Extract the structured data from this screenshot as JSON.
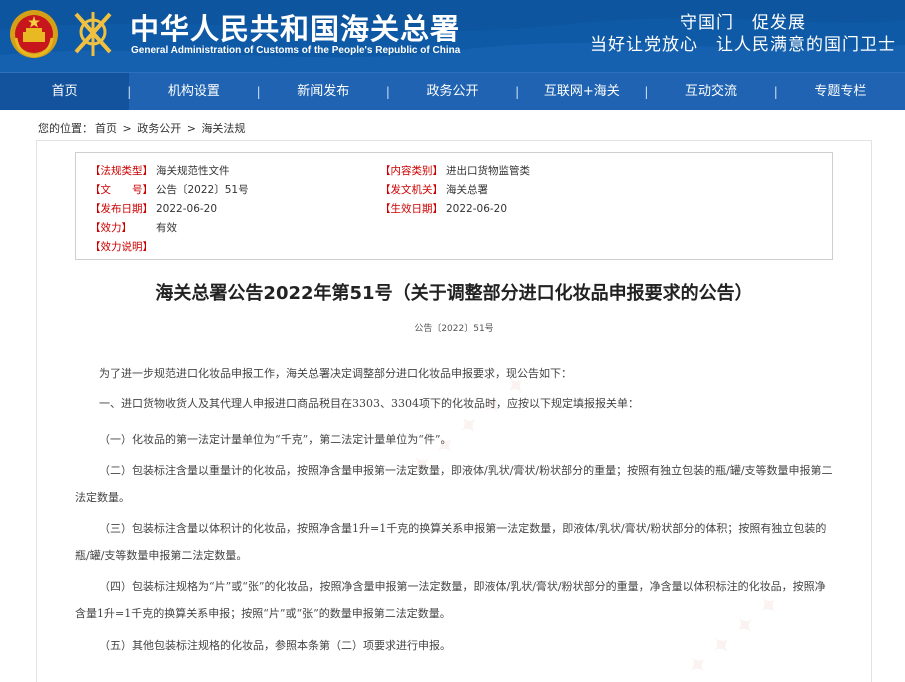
{
  "header": {
    "title": "中华人民共和国海关总署",
    "subtitle": "General Administration of Customs of the People's Republic of China",
    "slogan_line1": "守国门　促发展",
    "slogan_line2": "当好让党放心　让人民满意的国门卫士",
    "colors": {
      "header_bg": "#0f5aa6",
      "nav_bg": "#1f63b2",
      "key_red": "#cc0000"
    }
  },
  "nav": {
    "items": [
      {
        "label": "首页"
      },
      {
        "label": "机构设置"
      },
      {
        "label": "新闻发布"
      },
      {
        "label": "政务公开"
      },
      {
        "label": "互联网+海关"
      },
      {
        "label": "互动交流"
      },
      {
        "label": "专题专栏"
      }
    ],
    "separator": "|"
  },
  "breadcrumb": {
    "prefix": "您的位置：",
    "items": [
      "首页",
      "政务公开",
      "海关法规"
    ],
    "separator": " > "
  },
  "meta": {
    "type_key": "【法规类型】",
    "type_val": "海关规范性文件",
    "category_key": "【内容类别】",
    "category_val": "进出口货物监管类",
    "docno_key": "【文　　号】",
    "docno_val": "公告〔2022〕51号",
    "issuer_key": "【发文机关】",
    "issuer_val": "海关总署",
    "pubdate_key": "【发布日期】",
    "pubdate_val": "2022-06-20",
    "effdate_key": "【生效日期】",
    "effdate_val": "2022-06-20",
    "validity_key": "【效力】",
    "validity_val": "有效",
    "note_key": "【效力说明】",
    "note_val": ""
  },
  "document": {
    "title": "海关总署公告2022年第51号（关于调整部分进口化妆品申报要求的公告）",
    "number": "公告〔2022〕51号",
    "paragraphs": [
      "为了进一步规范进口化妆品申报工作，海关总署决定调整部分进口化妆品申报要求，现公告如下：",
      "一、进口货物收货人及其代理人申报进口商品税目在3303、3304项下的化妆品时，应按以下规定填报报关单：",
      "（一）化妆品的第一法定计量单位为“千克”，第二法定计量单位为“件”。",
      "（二）包装标注含量以重量计的化妆品，按照净含量申报第一法定数量，即液体/乳状/膏状/粉状部分的重量；按照有独立包装的瓶/罐/支等数量申报第二法定数量。",
      "（三）包装标注含量以体积计的化妆品，按照净含量1升=1千克的换算关系申报第一法定数量，即液体/乳状/膏状/粉状部分的体积；按照有独立包装的瓶/罐/支等数量申报第二法定数量。",
      "（四）包装标注规格为“片”或“张”的化妆品，按照净含量申报第一法定数量，即液体/乳状/膏状/粉状部分的重量，净含量以体积标注的化妆品，按照净含量1升=1千克的换算关系申报；按照“片”或“张”的数量申报第二法定数量。",
      "（五）其他包装标注规格的化妆品，参照本条第（二）项要求进行申报。"
    ]
  }
}
